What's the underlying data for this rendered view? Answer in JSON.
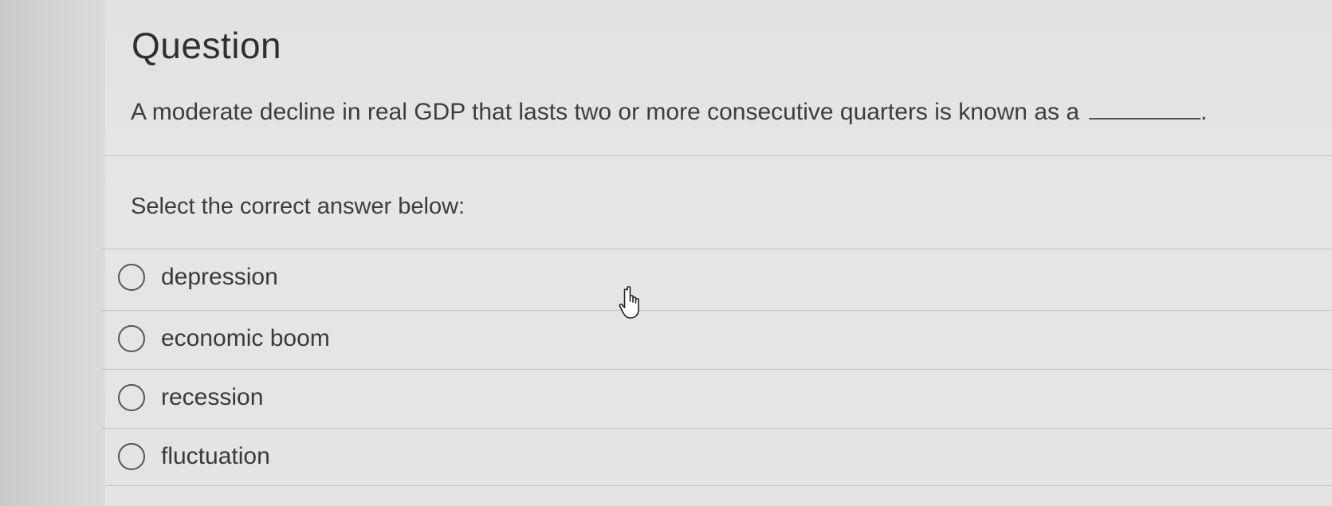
{
  "question": {
    "title": "Question",
    "prompt": "A moderate decline in real GDP that lasts two or more consecutive quarters is known as a",
    "prompt_end": "."
  },
  "instructions": "Select the correct answer below:",
  "options": [
    {
      "label": "depression"
    },
    {
      "label": "economic boom"
    },
    {
      "label": "recession"
    },
    {
      "label": "fluctuation"
    }
  ],
  "cursor": {
    "icon": "hand-pointer-icon"
  }
}
